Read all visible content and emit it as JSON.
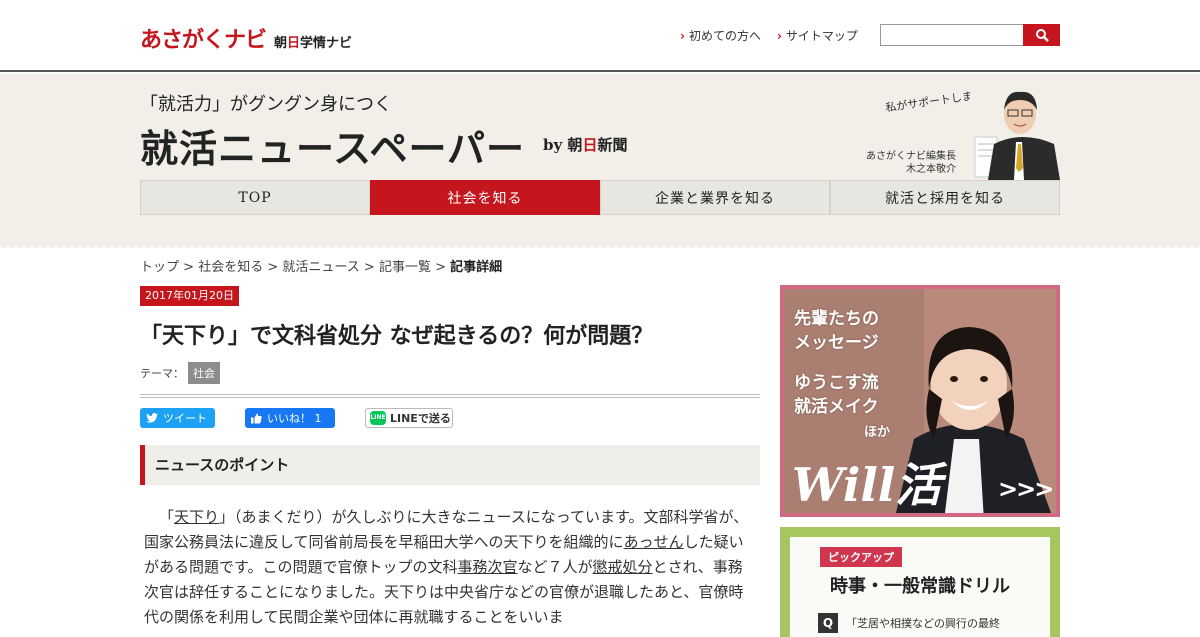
{
  "brand": {
    "logo_main": "あさがくナビ",
    "logo_sub_a": "朝",
    "logo_sub_b": "日",
    "logo_sub_c": "学情ナビ"
  },
  "top_links": {
    "first_time": "初めての方へ",
    "sitemap": "サイトマップ"
  },
  "search": {
    "value": "",
    "placeholder": ""
  },
  "header": {
    "tagline": "「就活力」がグングン身につく",
    "title": "就活ニュースペーパー",
    "by_prefix": "by 朝",
    "by_red": "日",
    "by_suffix": "新聞",
    "editor_note": "私がサポートします！",
    "editor_role": "あさがくナビ編集長",
    "editor_name": "木之本敬介"
  },
  "nav": [
    {
      "label": "TOP",
      "active": false
    },
    {
      "label": "社会を知る",
      "active": true
    },
    {
      "label": "企業と業界を知る",
      "active": false
    },
    {
      "label": "就活と採用を知る",
      "active": false
    }
  ],
  "breadcrumb": {
    "top": "トップ",
    "society": "社会を知る",
    "news": "就活ニュース",
    "list": "記事一覧",
    "current": "記事詳細",
    "sep": ">"
  },
  "article": {
    "date": "2017年01月20日",
    "title": "「天下り」で文科省処分 なぜ起きるの？何が問題？",
    "theme_label": "テーマ：",
    "theme": "社会",
    "section_head": "ニュースのポイント",
    "body_1": "「",
    "body_link_1": "天下り",
    "body_2": "」（あまくだり）が久しぶりに大きなニュースになっています。文部科学省が、国家公務員法に違反して同省前局長を早稲田大学への天下りを組織的に",
    "body_link_2": "あっせん",
    "body_3": "した疑いがある問題です。この問題で官僚トップの文科",
    "body_link_3": "事務次官",
    "body_4": "など７人が",
    "body_link_4": "懲戒処分",
    "body_5": "とされ、事務次官は辞任することになりました。天下りは中央省庁などの官僚が退職したあと、官僚時代の関係を利用して民間企業や団体に再就職することをいいま"
  },
  "social": {
    "tweet": "ツイート",
    "like": "いいね！ 1",
    "line": "LINEで送る"
  },
  "ad_will": {
    "line1": "先輩たちの",
    "line2": "メッセージ",
    "line3": "ゆうこす流",
    "line4": "就活メイク",
    "line5": "ほか",
    "logo": "Will活",
    "arrows": ">>>"
  },
  "ad_drill": {
    "pickup": "ピックアップ",
    "title": "時事・一般常識ドリル",
    "q_mark": "Q",
    "question": "「芝居や相撲などの興行の最終"
  },
  "colors": {
    "accent": "#c4161c",
    "header_bg": "#f2efe9",
    "ad_green": "#a6c760",
    "ad_pink": "#d16a80"
  }
}
